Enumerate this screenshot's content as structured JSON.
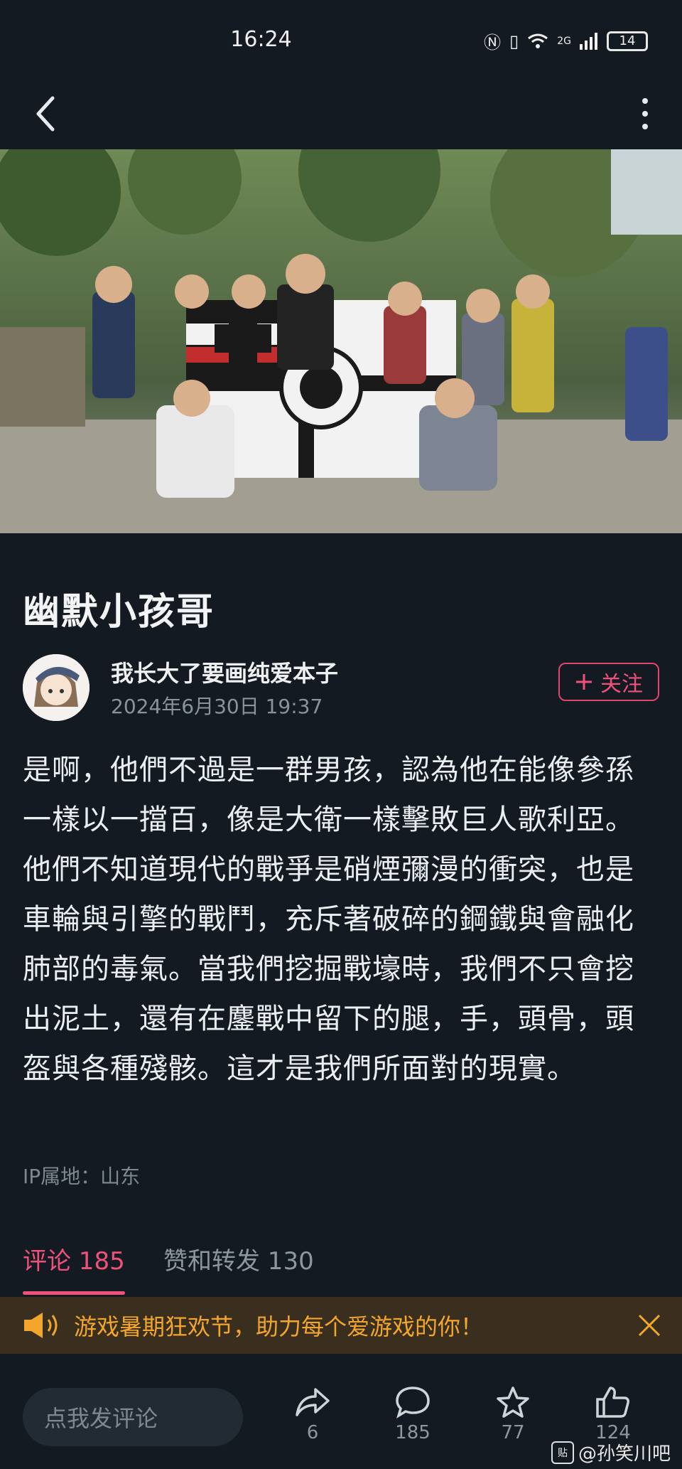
{
  "status_bar": {
    "time": "16:24",
    "network": "2G",
    "battery": "14"
  },
  "post": {
    "title": "幽默小孩哥",
    "author": "我长大了要画纯爱本子",
    "date": "2024年6月30日 19:37",
    "follow_label": "关注",
    "body": "是啊，他們不過是一群男孩，認為他在能像參孫一樣以一擋百，像是大衛一樣擊敗巨人歌利亞。他們不知道現代的戰爭是硝煙彌漫的衝突，也是車輪與引擎的戰鬥，充斥著破碎的鋼鐵與會融化肺部的毒氣。當我們挖掘戰壕時，我們不只會挖出泥土，還有在鏖戰中留下的腿，手，頭骨，頭盔與各種殘骸。這才是我們所面對的現實。",
    "ip_location": "IP属地：山东"
  },
  "tabs": {
    "comments": "评论 185",
    "likes_shares": "赞和转发 130"
  },
  "banner": {
    "text": "游戏暑期狂欢节，助力每个爱游戏的你！"
  },
  "bottom_bar": {
    "comment_placeholder": "点我发评论",
    "share_count": "6",
    "comment_count": "185",
    "favorite_count": "77",
    "like_count": "124"
  },
  "watermark": {
    "badge": "贴",
    "text": "@孙笑川吧"
  },
  "colors": {
    "accent": "#f0517a",
    "background": "#131a21",
    "banner_text": "#f3a62c"
  }
}
